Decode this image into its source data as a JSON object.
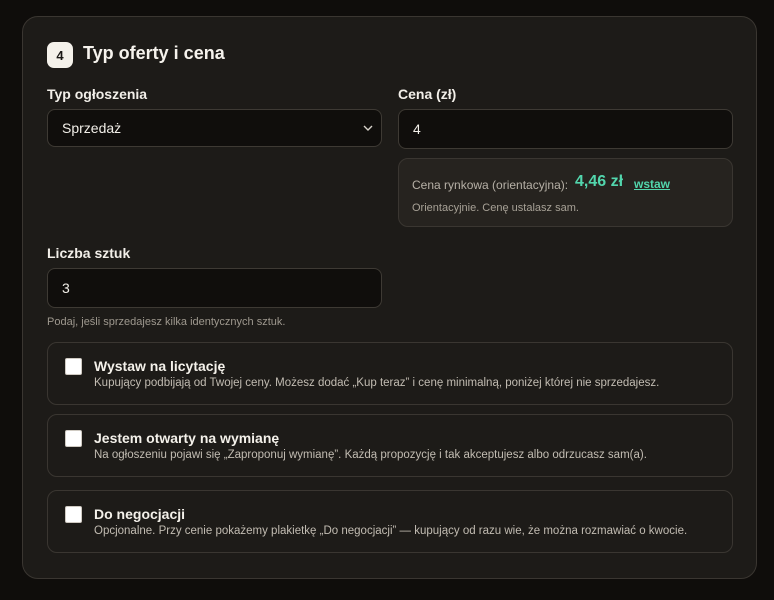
{
  "section": {
    "step": "4",
    "title": "Typ oferty i cena"
  },
  "offer_type": {
    "label": "Typ ogłoszenia",
    "selected": "Sprzedaż"
  },
  "price": {
    "label": "Cena (zł)",
    "value": "4",
    "market": {
      "label": "Cena rynkowa (orientacyjna):",
      "value": "4,46 zł",
      "insert_label": "wstaw",
      "note": "Orientacyjnie. Cenę ustalasz sam."
    }
  },
  "quantity": {
    "label": "Liczba sztuk",
    "value": "3",
    "hint": "Podaj, jeśli sprzedajesz kilka identycznych sztuk."
  },
  "options": [
    {
      "title": "Wystaw na licytację",
      "description": "Kupujący podbijają od Twojej ceny. Możesz dodać „Kup teraz” i cenę minimalną, poniżej której nie sprzedajesz."
    },
    {
      "title": "Jestem otwarty na wymianę",
      "description": "Na ogłoszeniu pojawi się „Zaproponuj wymianę”. Każdą propozycję i tak akceptujesz albo odrzucasz sam(a)."
    },
    {
      "title": "Do negocjacji",
      "description": "Opcjonalne. Przy cenie pokażemy plakietkę „Do negocjacji” — kupujący od razu wie, że można rozmawiać o kwocie."
    }
  ],
  "colors": {
    "accent": "#52d6ad",
    "card_bg": "#1d1b18",
    "input_bg": "#100e0c"
  }
}
